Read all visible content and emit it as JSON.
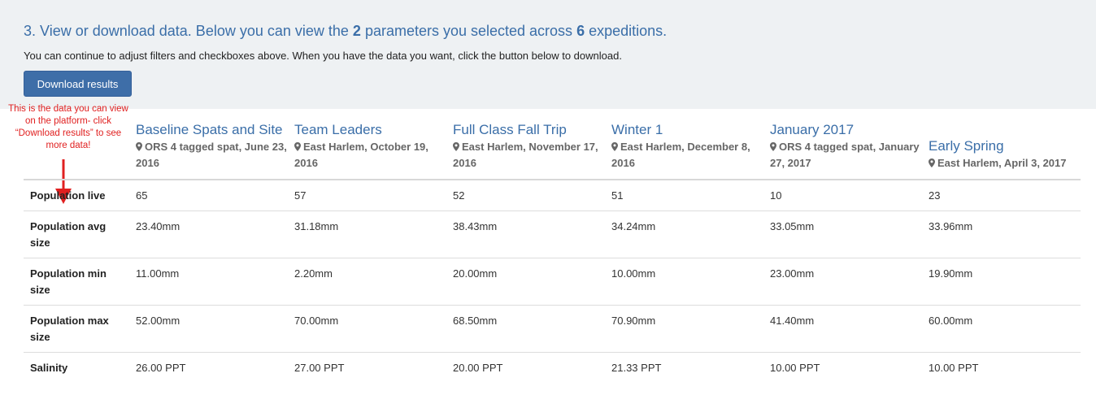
{
  "panel": {
    "heading_pre": "3. View or download data. Below you can view the ",
    "param_count": "2",
    "heading_mid": " parameters you selected across ",
    "expedition_count": "6",
    "heading_post": " expeditions.",
    "subtext": "You can continue to adjust filters and checkboxes above. When you have the data you want, click the button below to download.",
    "download_label": "Download results"
  },
  "annotation": {
    "text": "This is the data you can view on the platform- click “Download results” to see more data!",
    "color": "#e02020"
  },
  "columns": [
    {
      "title": "Baseline Spats and Site",
      "subtitle": "ORS 4 tagged spat, June 23, 2016"
    },
    {
      "title": "Team Leaders",
      "subtitle": "East Harlem, October 19, 2016"
    },
    {
      "title": "Full Class Fall Trip",
      "subtitle": "East Harlem, November 17, 2016"
    },
    {
      "title": "Winter 1",
      "subtitle": "East Harlem, December 8, 2016"
    },
    {
      "title": "January 2017",
      "subtitle": "ORS 4 tagged spat, January 27, 2017"
    },
    {
      "title": "Early Spring",
      "subtitle": "East Harlem, April 3, 2017"
    }
  ],
  "rows": [
    {
      "label": "Population live",
      "values": [
        "65",
        "57",
        "52",
        "51",
        "10",
        "23"
      ]
    },
    {
      "label": "Population avg size",
      "values": [
        "23.40mm",
        "31.18mm",
        "38.43mm",
        "34.24mm",
        "33.05mm",
        "33.96mm"
      ]
    },
    {
      "label": "Population min size",
      "values": [
        "11.00mm",
        "2.20mm",
        "20.00mm",
        "10.00mm",
        "23.00mm",
        "19.90mm"
      ]
    },
    {
      "label": "Population max size",
      "values": [
        "52.00mm",
        "70.00mm",
        "68.50mm",
        "70.90mm",
        "41.40mm",
        "60.00mm"
      ]
    },
    {
      "label": "Salinity",
      "values": [
        "26.00 PPT",
        "27.00 PPT",
        "20.00 PPT",
        "21.33 PPT",
        "10.00 PPT",
        "10.00 PPT"
      ]
    }
  ],
  "icons": {
    "location": "map-marker-icon",
    "annotation_arrow": "down-arrow-icon"
  },
  "colors": {
    "accent": "#3a6ea8",
    "button": "#3e6ea8",
    "panel_bg": "#eef1f3"
  }
}
